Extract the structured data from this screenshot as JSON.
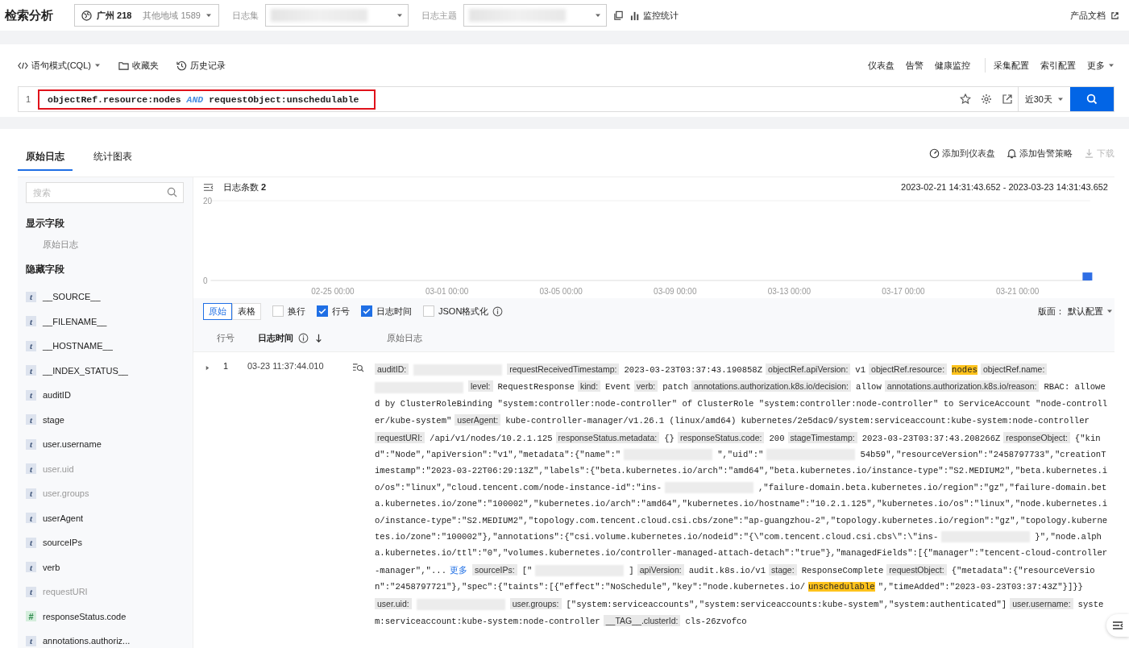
{
  "header": {
    "title": "检索分析",
    "region": {
      "name": "广州",
      "count": "218",
      "other_label": "其他地域",
      "other_count": "1589"
    },
    "selects": [
      {
        "label": "日志集",
        "redacted": true
      },
      {
        "label": "日志主题",
        "redacted": true
      }
    ],
    "monitor_link": "监控统计",
    "docs_link": "产品文档"
  },
  "query": {
    "mode": "语句模式(CQL)",
    "favorites": "收藏夹",
    "history": "历史记录",
    "links_left": [
      "仪表盘",
      "告警",
      "健康监控"
    ],
    "links_right": [
      "采集配置",
      "索引配置"
    ],
    "more": "更多",
    "line_number": "1",
    "tokens": [
      {
        "kind": "text",
        "text": "objectRef.resource:nodes "
      },
      {
        "kind": "operator",
        "text": "AND"
      },
      {
        "kind": "text",
        "text": " requestObject:unschedulable"
      }
    ],
    "highlighted": true,
    "time_range": "近30天"
  },
  "tabs": [
    {
      "label": "原始日志",
      "selected": true
    },
    {
      "label": "统计图表",
      "selected": false
    }
  ],
  "actions": [
    {
      "label": "添加到仪表盘",
      "disabled": false
    },
    {
      "label": "添加告警策略",
      "disabled": false
    },
    {
      "label": "下载",
      "disabled": true
    }
  ],
  "sidebar": {
    "search_placeholder": "搜索",
    "shown_title": "显示字段",
    "shown_fields": [
      "原始日志"
    ],
    "hidden_title": "隐藏字段",
    "hidden_fields": [
      {
        "type": "t",
        "name": "__SOURCE__",
        "muted": false
      },
      {
        "type": "t",
        "name": "__FILENAME__",
        "muted": false
      },
      {
        "type": "t",
        "name": "__HOSTNAME__",
        "muted": false
      },
      {
        "type": "t",
        "name": "__INDEX_STATUS__",
        "muted": false
      },
      {
        "type": "t",
        "name": "auditID",
        "muted": false
      },
      {
        "type": "t",
        "name": "stage",
        "muted": false
      },
      {
        "type": "t",
        "name": "user.username",
        "muted": false
      },
      {
        "type": "t",
        "name": "user.uid",
        "muted": true
      },
      {
        "type": "t",
        "name": "user.groups",
        "muted": true
      },
      {
        "type": "t",
        "name": "userAgent",
        "muted": false
      },
      {
        "type": "t",
        "name": "sourceIPs",
        "muted": false
      },
      {
        "type": "t",
        "name": "verb",
        "muted": false
      },
      {
        "type": "t",
        "name": "requestURI",
        "muted": true
      },
      {
        "type": "#",
        "name": "responseStatus.code",
        "muted": false
      },
      {
        "type": "t",
        "name": "annotations.authoriz...",
        "muted": false
      }
    ]
  },
  "histogram": {
    "count_label": "日志条数 **2**",
    "time_range": "2023-02-21 14:31:43.652 - 2023-03-23 14:31:43.652",
    "chart_data": {
      "type": "bar",
      "ylim": [
        0,
        20
      ],
      "yticks": [
        0,
        20
      ],
      "categories": [
        null,
        null,
        null,
        null,
        "02-25 00:00",
        null,
        null,
        null,
        "03-01 00:00",
        null,
        null,
        null,
        "03-05 00:00",
        null,
        null,
        null,
        "03-09 00:00",
        null,
        null,
        null,
        "03-13 00:00",
        null,
        null,
        null,
        "03-17 00:00",
        null,
        null,
        null,
        "03-21 00:00",
        null,
        null
      ],
      "values": [
        0,
        0,
        0,
        0,
        0,
        0,
        0,
        0,
        0,
        0,
        0,
        0,
        0,
        0,
        0,
        0,
        0,
        0,
        0,
        0,
        0,
        0,
        0,
        0,
        0,
        0,
        0,
        0,
        0,
        0,
        2
      ]
    }
  },
  "view": {
    "modes": [
      {
        "label": "原始",
        "selected": true
      },
      {
        "label": "表格",
        "selected": false
      }
    ],
    "options": [
      {
        "label": "换行",
        "checked": false
      },
      {
        "label": "行号",
        "checked": true
      },
      {
        "label": "日志时间",
        "checked": true
      },
      {
        "label": "JSON格式化",
        "checked": false,
        "info": true
      }
    ],
    "layout_label": "版面：",
    "layout_value": "默认配置"
  },
  "table": {
    "columns": [
      "行号",
      "日志时间",
      "原始日志"
    ],
    "rows": [
      {
        "expanded": false,
        "number": "1",
        "time": "03-23 11:37:44.010",
        "segments": [
          {
            "kind": "key",
            "text": "auditID:"
          },
          {
            "kind": "redacted"
          },
          {
            "kind": "key",
            "text": "requestReceivedTimestamp:"
          },
          {
            "kind": "text",
            "text": "2023-03-23T03:37:43.190858Z"
          },
          {
            "kind": "key",
            "text": "objectRef.apiVersion:"
          },
          {
            "kind": "text",
            "text": "v1"
          },
          {
            "kind": "key",
            "text": "objectRef.resource:"
          },
          {
            "kind": "hit",
            "text": "nodes"
          },
          {
            "kind": "key",
            "text": "objectRef.name:"
          },
          {
            "kind": "redacted"
          },
          {
            "kind": "key",
            "text": "level:"
          },
          {
            "kind": "text",
            "text": "RequestResponse"
          },
          {
            "kind": "key",
            "text": "kind:"
          },
          {
            "kind": "text",
            "text": "Event"
          },
          {
            "kind": "key",
            "text": "verb:"
          },
          {
            "kind": "text",
            "text": "patch"
          },
          {
            "kind": "key",
            "text": "annotations.authorization.k8s.io/decision:"
          },
          {
            "kind": "text",
            "text": "allow"
          },
          {
            "kind": "key",
            "text": "annotations.authorization.k8s.io/reason:"
          },
          {
            "kind": "text",
            "text": "RBAC: allowed by ClusterRoleBinding \"system:controller:node-controller\" of ClusterRole \"system:controller:node-controller\" to ServiceAccount \"node-controller/kube-system\""
          },
          {
            "kind": "key",
            "text": "userAgent:"
          },
          {
            "kind": "text",
            "text": "kube-controller-manager/v1.26.1 (linux/amd64) kubernetes/2e5dac9/system:serviceaccount:kube-system:node-controller"
          },
          {
            "kind": "key",
            "text": "requestURI:"
          },
          {
            "kind": "text",
            "text": "/api/v1/nodes/10.2.1.125"
          },
          {
            "kind": "key",
            "text": "responseStatus.metadata:"
          },
          {
            "kind": "text",
            "text": "{}"
          },
          {
            "kind": "key",
            "text": "responseStatus.code:"
          },
          {
            "kind": "text",
            "text": "200"
          },
          {
            "kind": "key",
            "text": "stageTimestamp:"
          },
          {
            "kind": "text",
            "text": "2023-03-23T03:37:43.208266Z"
          },
          {
            "kind": "key",
            "text": "responseObject:"
          },
          {
            "kind": "text",
            "text": "{\"kind\":\"Node\",\"apiVersion\":\"v1\",\"metadata\":{\"name\":\""
          },
          {
            "kind": "redacted"
          },
          {
            "kind": "text",
            "text": "\",\"uid\":\""
          },
          {
            "kind": "redacted"
          },
          {
            "kind": "text",
            "text": "54b59\",\"resourceVersion\":\"2458797733\",\"creationTimestamp\":\"2023-03-22T06:29:13Z\",\"labels\":{\"beta.kubernetes.io/arch\":\"amd64\",\"beta.kubernetes.io/instance-type\":\"S2.MEDIUM2\",\"beta.kubernetes.io/os\":\"linux\",\"cloud.tencent.com/node-instance-id\":\"ins-"
          },
          {
            "kind": "redacted"
          },
          {
            "kind": "text",
            "text": ",\"failure-domain.beta.kubernetes.io/region\":\"gz\",\"failure-domain.beta.kubernetes.io/zone\":\"100002\",\"kubernetes.io/arch\":\"amd64\",\"kubernetes.io/hostname\":\"10.2.1.125\",\"kubernetes.io/os\":\"linux\",\"node.kubernetes.io/instance-type\":\"S2.MEDIUM2\",\"topology.com.tencent.cloud.csi.cbs/zone\":\"ap-guangzhou-2\",\"topology.kubernetes.io/region\":\"gz\",\"topology.kubernetes.io/zone\":\"100002\"},\"annotations\":{\"csi.volume.kubernetes.io/nodeid\":\"{\\\"com.tencent.cloud.csi.cbs\\\":\\\"ins-"
          },
          {
            "kind": "redacted"
          },
          {
            "kind": "text",
            "text": "}\",\"node.alpha.kubernetes.io/ttl\":\"0\",\"volumes.kubernetes.io/controller-managed-attach-detach\":\"true\"},\"managedFields\":[{\"manager\":\"tencent-cloud-controller-manager\",\"..."
          },
          {
            "kind": "link",
            "text": "更多"
          },
          {
            "kind": "key",
            "text": "sourceIPs:"
          },
          {
            "kind": "text",
            "text": "[\""
          },
          {
            "kind": "redacted"
          },
          {
            "kind": "text",
            "text": "]"
          },
          {
            "kind": "key",
            "text": "apiVersion:"
          },
          {
            "kind": "text",
            "text": "audit.k8s.io/v1"
          },
          {
            "kind": "key",
            "text": "stage:"
          },
          {
            "kind": "text",
            "text": "ResponseComplete"
          },
          {
            "kind": "key",
            "text": "requestObject:"
          },
          {
            "kind": "text",
            "text": "{\"metadata\":{\"resourceVersion\":\"2458797721\"},\"spec\":{\"taints\":[{\"effect\":\"NoSchedule\",\"key\":\"node.kubernetes.io/"
          },
          {
            "kind": "hit",
            "text": "unschedulable"
          },
          {
            "kind": "text",
            "text": "\",\"timeAdded\":\"2023-03-23T03:37:43Z\"}]}}"
          },
          {
            "kind": "key",
            "text": "user.uid:"
          },
          {
            "kind": "redacted"
          },
          {
            "kind": "key",
            "text": "user.groups:"
          },
          {
            "kind": "text",
            "text": "[\"system:serviceaccounts\",\"system:serviceaccounts:kube-system\",\"system:authenticated\"]"
          },
          {
            "kind": "key",
            "text": "user.username:"
          },
          {
            "kind": "text",
            "text": "system:serviceaccount:kube-system:node-controller"
          },
          {
            "kind": "key",
            "text": "__TAG__.clusterId:"
          },
          {
            "kind": "text",
            "text": "cls-26zvofco"
          }
        ]
      }
    ]
  }
}
